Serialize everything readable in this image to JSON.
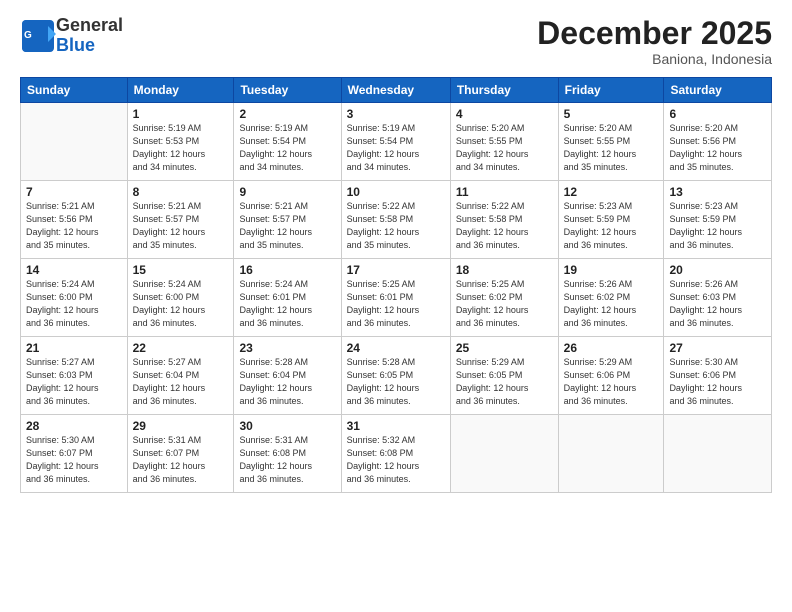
{
  "header": {
    "logo_line1": "General",
    "logo_line2": "Blue",
    "month_year": "December 2025",
    "location": "Baniona, Indonesia"
  },
  "days_of_week": [
    "Sunday",
    "Monday",
    "Tuesday",
    "Wednesday",
    "Thursday",
    "Friday",
    "Saturday"
  ],
  "weeks": [
    [
      {
        "day": "",
        "info": ""
      },
      {
        "day": "1",
        "info": "Sunrise: 5:19 AM\nSunset: 5:53 PM\nDaylight: 12 hours\nand 34 minutes."
      },
      {
        "day": "2",
        "info": "Sunrise: 5:19 AM\nSunset: 5:54 PM\nDaylight: 12 hours\nand 34 minutes."
      },
      {
        "day": "3",
        "info": "Sunrise: 5:19 AM\nSunset: 5:54 PM\nDaylight: 12 hours\nand 34 minutes."
      },
      {
        "day": "4",
        "info": "Sunrise: 5:20 AM\nSunset: 5:55 PM\nDaylight: 12 hours\nand 34 minutes."
      },
      {
        "day": "5",
        "info": "Sunrise: 5:20 AM\nSunset: 5:55 PM\nDaylight: 12 hours\nand 35 minutes."
      },
      {
        "day": "6",
        "info": "Sunrise: 5:20 AM\nSunset: 5:56 PM\nDaylight: 12 hours\nand 35 minutes."
      }
    ],
    [
      {
        "day": "7",
        "info": "Sunrise: 5:21 AM\nSunset: 5:56 PM\nDaylight: 12 hours\nand 35 minutes."
      },
      {
        "day": "8",
        "info": "Sunrise: 5:21 AM\nSunset: 5:57 PM\nDaylight: 12 hours\nand 35 minutes."
      },
      {
        "day": "9",
        "info": "Sunrise: 5:21 AM\nSunset: 5:57 PM\nDaylight: 12 hours\nand 35 minutes."
      },
      {
        "day": "10",
        "info": "Sunrise: 5:22 AM\nSunset: 5:58 PM\nDaylight: 12 hours\nand 35 minutes."
      },
      {
        "day": "11",
        "info": "Sunrise: 5:22 AM\nSunset: 5:58 PM\nDaylight: 12 hours\nand 36 minutes."
      },
      {
        "day": "12",
        "info": "Sunrise: 5:23 AM\nSunset: 5:59 PM\nDaylight: 12 hours\nand 36 minutes."
      },
      {
        "day": "13",
        "info": "Sunrise: 5:23 AM\nSunset: 5:59 PM\nDaylight: 12 hours\nand 36 minutes."
      }
    ],
    [
      {
        "day": "14",
        "info": "Sunrise: 5:24 AM\nSunset: 6:00 PM\nDaylight: 12 hours\nand 36 minutes."
      },
      {
        "day": "15",
        "info": "Sunrise: 5:24 AM\nSunset: 6:00 PM\nDaylight: 12 hours\nand 36 minutes."
      },
      {
        "day": "16",
        "info": "Sunrise: 5:24 AM\nSunset: 6:01 PM\nDaylight: 12 hours\nand 36 minutes."
      },
      {
        "day": "17",
        "info": "Sunrise: 5:25 AM\nSunset: 6:01 PM\nDaylight: 12 hours\nand 36 minutes."
      },
      {
        "day": "18",
        "info": "Sunrise: 5:25 AM\nSunset: 6:02 PM\nDaylight: 12 hours\nand 36 minutes."
      },
      {
        "day": "19",
        "info": "Sunrise: 5:26 AM\nSunset: 6:02 PM\nDaylight: 12 hours\nand 36 minutes."
      },
      {
        "day": "20",
        "info": "Sunrise: 5:26 AM\nSunset: 6:03 PM\nDaylight: 12 hours\nand 36 minutes."
      }
    ],
    [
      {
        "day": "21",
        "info": "Sunrise: 5:27 AM\nSunset: 6:03 PM\nDaylight: 12 hours\nand 36 minutes."
      },
      {
        "day": "22",
        "info": "Sunrise: 5:27 AM\nSunset: 6:04 PM\nDaylight: 12 hours\nand 36 minutes."
      },
      {
        "day": "23",
        "info": "Sunrise: 5:28 AM\nSunset: 6:04 PM\nDaylight: 12 hours\nand 36 minutes."
      },
      {
        "day": "24",
        "info": "Sunrise: 5:28 AM\nSunset: 6:05 PM\nDaylight: 12 hours\nand 36 minutes."
      },
      {
        "day": "25",
        "info": "Sunrise: 5:29 AM\nSunset: 6:05 PM\nDaylight: 12 hours\nand 36 minutes."
      },
      {
        "day": "26",
        "info": "Sunrise: 5:29 AM\nSunset: 6:06 PM\nDaylight: 12 hours\nand 36 minutes."
      },
      {
        "day": "27",
        "info": "Sunrise: 5:30 AM\nSunset: 6:06 PM\nDaylight: 12 hours\nand 36 minutes."
      }
    ],
    [
      {
        "day": "28",
        "info": "Sunrise: 5:30 AM\nSunset: 6:07 PM\nDaylight: 12 hours\nand 36 minutes."
      },
      {
        "day": "29",
        "info": "Sunrise: 5:31 AM\nSunset: 6:07 PM\nDaylight: 12 hours\nand 36 minutes."
      },
      {
        "day": "30",
        "info": "Sunrise: 5:31 AM\nSunset: 6:08 PM\nDaylight: 12 hours\nand 36 minutes."
      },
      {
        "day": "31",
        "info": "Sunrise: 5:32 AM\nSunset: 6:08 PM\nDaylight: 12 hours\nand 36 minutes."
      },
      {
        "day": "",
        "info": ""
      },
      {
        "day": "",
        "info": ""
      },
      {
        "day": "",
        "info": ""
      }
    ]
  ]
}
